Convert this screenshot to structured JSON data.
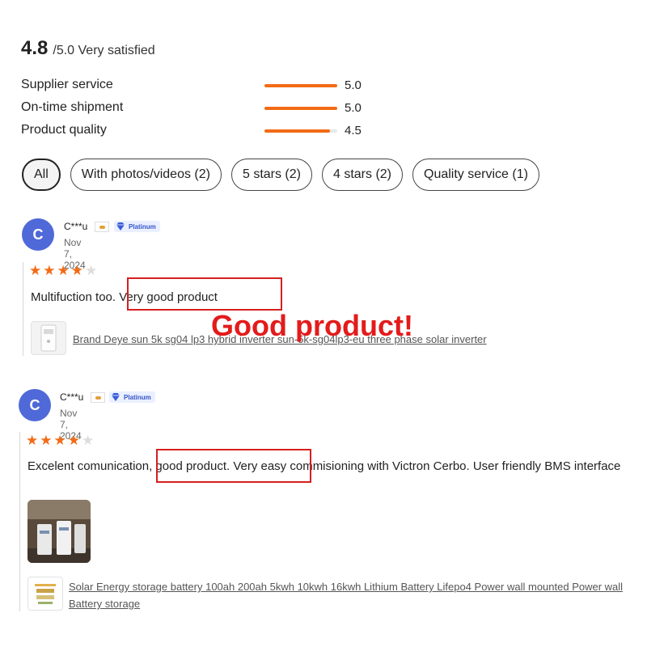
{
  "summary": {
    "score": "4.8",
    "out_of": "/5.0 Very satisfied"
  },
  "ratings": [
    {
      "label": "Supplier service",
      "value": "5.0",
      "level": 1.0
    },
    {
      "label": "On-time shipment",
      "value": "5.0",
      "level": 1.0
    },
    {
      "label": "Product quality",
      "value": "4.5",
      "level": 0.9
    }
  ],
  "filters": [
    {
      "label": "All",
      "active": true
    },
    {
      "label": "With photos/videos (2)",
      "active": false
    },
    {
      "label": "5 stars (2)",
      "active": false
    },
    {
      "label": "4 stars (2)",
      "active": false
    },
    {
      "label": "Quality service (1)",
      "active": false
    }
  ],
  "reviews": [
    {
      "avatar_letter": "C",
      "name": "C***u",
      "badge": "Platinum",
      "date": "Nov 7, 2024",
      "stars": 4,
      "text": "Multifuction too. Very good product",
      "product": "Brand Deye sun 5k sg04 lp3 hybrid inverter sun-5k-sg04lp3-eu three phase solar inverter"
    },
    {
      "avatar_letter": "C",
      "name": "C***u",
      "badge": "Platinum",
      "date": "Nov 7, 2024",
      "stars": 4,
      "text": "Excelent comunication, good product. Very easy commisioning with Victron Cerbo. User friendly BMS interface",
      "product": "Solar Energy storage battery 100ah 200ah 5kwh 10kwh 16kwh Lithium Battery Lifepo4 Power wall mounted Power wall Battery storage"
    }
  ],
  "annotation": {
    "text": "Good product!"
  },
  "colors": {
    "accent": "#f26b16",
    "avatar": "#5069d8",
    "annotation": "#e31b1b"
  }
}
